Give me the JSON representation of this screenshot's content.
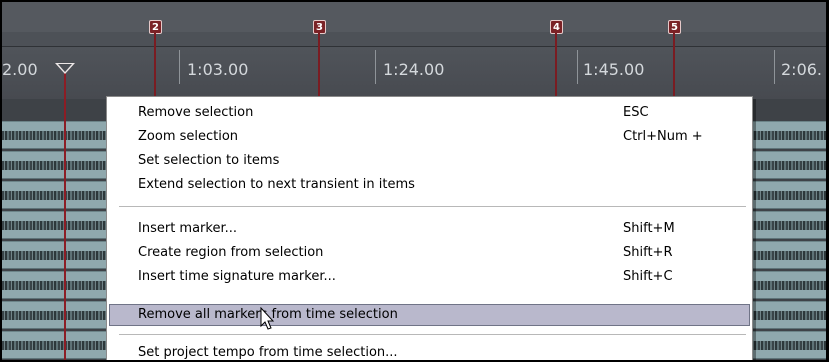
{
  "timeline": {
    "markers": [
      {
        "id": "2",
        "label": "2"
      },
      {
        "id": "3",
        "label": "3"
      },
      {
        "id": "4",
        "label": "4"
      },
      {
        "id": "5",
        "label": "5"
      }
    ],
    "time_labels": [
      "2.00",
      "1:03.00",
      "1:24.00",
      "1:45.00",
      "2:06."
    ]
  },
  "context_menu": {
    "items": [
      {
        "label": "Remove selection",
        "shortcut": "ESC"
      },
      {
        "label": "Zoom selection",
        "shortcut": "Ctrl+Num +"
      },
      {
        "label": "Set selection to items",
        "shortcut": ""
      },
      {
        "label": "Extend selection to next transient in items",
        "shortcut": ""
      },
      {
        "label": "Insert marker...",
        "shortcut": "Shift+M"
      },
      {
        "label": "Create region from selection",
        "shortcut": "Shift+R"
      },
      {
        "label": "Insert time signature marker...",
        "shortcut": "Shift+C"
      },
      {
        "label": "Remove all markers from time selection",
        "shortcut": ""
      },
      {
        "label": "Set project tempo from time selection...",
        "shortcut": ""
      }
    ],
    "highlighted_item": "Remove all markers from time selection"
  },
  "colors": {
    "marker": "#7a2226",
    "menu_highlight": "#b9b8cc",
    "ruler_background": "#4b4f55"
  },
  "icons": {
    "play_cursor": "play-cursor-icon",
    "mouse_pointer": "mouse-pointer-icon"
  }
}
